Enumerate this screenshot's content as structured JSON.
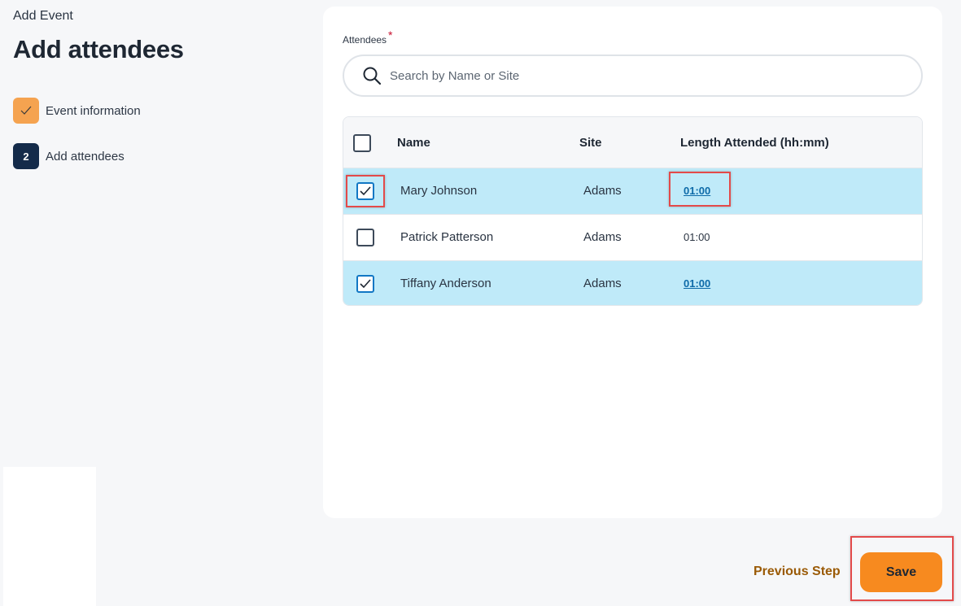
{
  "header": {
    "breadcrumb": "Add Event",
    "title": "Add attendees"
  },
  "steps": [
    {
      "label": "Event information",
      "state": "complete",
      "icon": "check-icon"
    },
    {
      "label": "Add attendees",
      "state": "current",
      "number": "2"
    }
  ],
  "attendees_field": {
    "label": "Attendees",
    "required_marker": "*",
    "search_placeholder": "Search by Name or Site"
  },
  "table": {
    "columns": [
      "Name",
      "Site",
      "Length Attended (hh:mm)"
    ],
    "select_all_checked": false,
    "rows": [
      {
        "name": "Mary Johnson",
        "site": "Adams",
        "length": "01:00",
        "checked": true
      },
      {
        "name": "Patrick Patterson",
        "site": "Adams",
        "length": "01:00",
        "checked": false
      },
      {
        "name": "Tiffany Anderson",
        "site": "Adams",
        "length": "01:00",
        "checked": true
      }
    ]
  },
  "footer": {
    "previous_label": "Previous Step",
    "save_label": "Save"
  },
  "colors": {
    "accent_orange": "#f78a1f",
    "step_done": "#f5a350",
    "step_current": "#142b4a",
    "row_selected": "#bfeaf9",
    "link_blue": "#0d6aa8",
    "highlight_red": "#e34a4a",
    "previous_step_text": "#9a5a06"
  }
}
